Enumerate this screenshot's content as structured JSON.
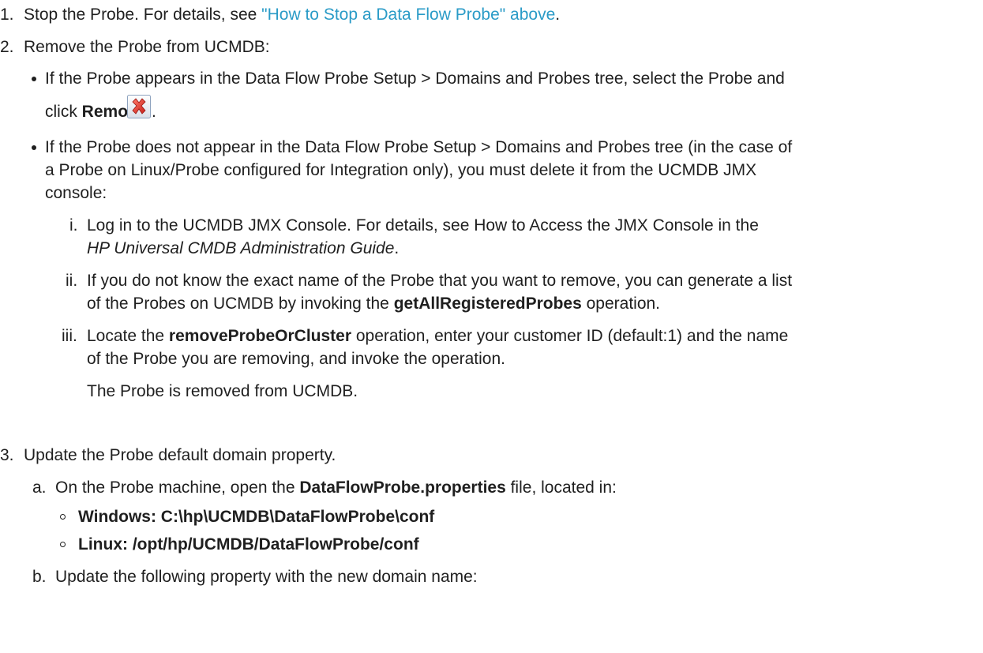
{
  "steps": {
    "s1": {
      "num": "1.",
      "pre": "Stop the Probe. For details, see ",
      "link": "\"How to Stop a Data Flow Probe\" above",
      "post": "."
    },
    "s2": {
      "num": "2.",
      "text": "Remove the Probe from UCMDB:",
      "b1": {
        "line1": "If the Probe appears in the Data Flow Probe Setup > Domains and Probes tree, select the Probe and",
        "line2_pre": "click ",
        "line2_bold": "Remove",
        "line2_post": ".",
        "icon": "remove-icon"
      },
      "b2": {
        "line1": "If the Probe does not appear in the Data Flow Probe Setup > Domains and Probes tree (in the case of",
        "line2": "a Probe on Linux/Probe configured for Integration only), you must delete it from the UCMDB JMX",
        "line3": "console:"
      },
      "i": {
        "num": "i.",
        "line1": "Log in to the UCMDB JMX Console. For details, see How to Access the JMX Console in the",
        "line2_italic": "HP Universal CMDB Administration Guide",
        "line2_post": "."
      },
      "ii": {
        "num": "ii.",
        "line1": "If you do not know the exact name of the Probe that you want to remove, you can generate a list",
        "line2_pre": "of the Probes on UCMDB by invoking the ",
        "line2_bold": "getAllRegisteredProbes",
        "line2_post": " operation."
      },
      "iii": {
        "num": "iii.",
        "line1_pre": "Locate the ",
        "line1_bold": "removeProbeOrCluster",
        "line1_post": " operation, enter your customer ID (default:1) and the name",
        "line2": "of the Probe you are removing, and invoke the operation.",
        "line3": "The Probe is removed from UCMDB."
      }
    },
    "s3": {
      "num": "3.",
      "text": "Update the Probe default domain property.",
      "a": {
        "num": "a.",
        "pre": "On the Probe machine, open the ",
        "bold": "DataFlowProbe.properties",
        "post": " file, located in:",
        "win": "Windows: C:\\hp\\UCMDB\\DataFlowProbe\\conf",
        "linux": "Linux: /opt/hp/UCMDB/DataFlowProbe/conf"
      },
      "b": {
        "num": "b.",
        "text": "Update the following property with the new domain name:"
      }
    }
  }
}
